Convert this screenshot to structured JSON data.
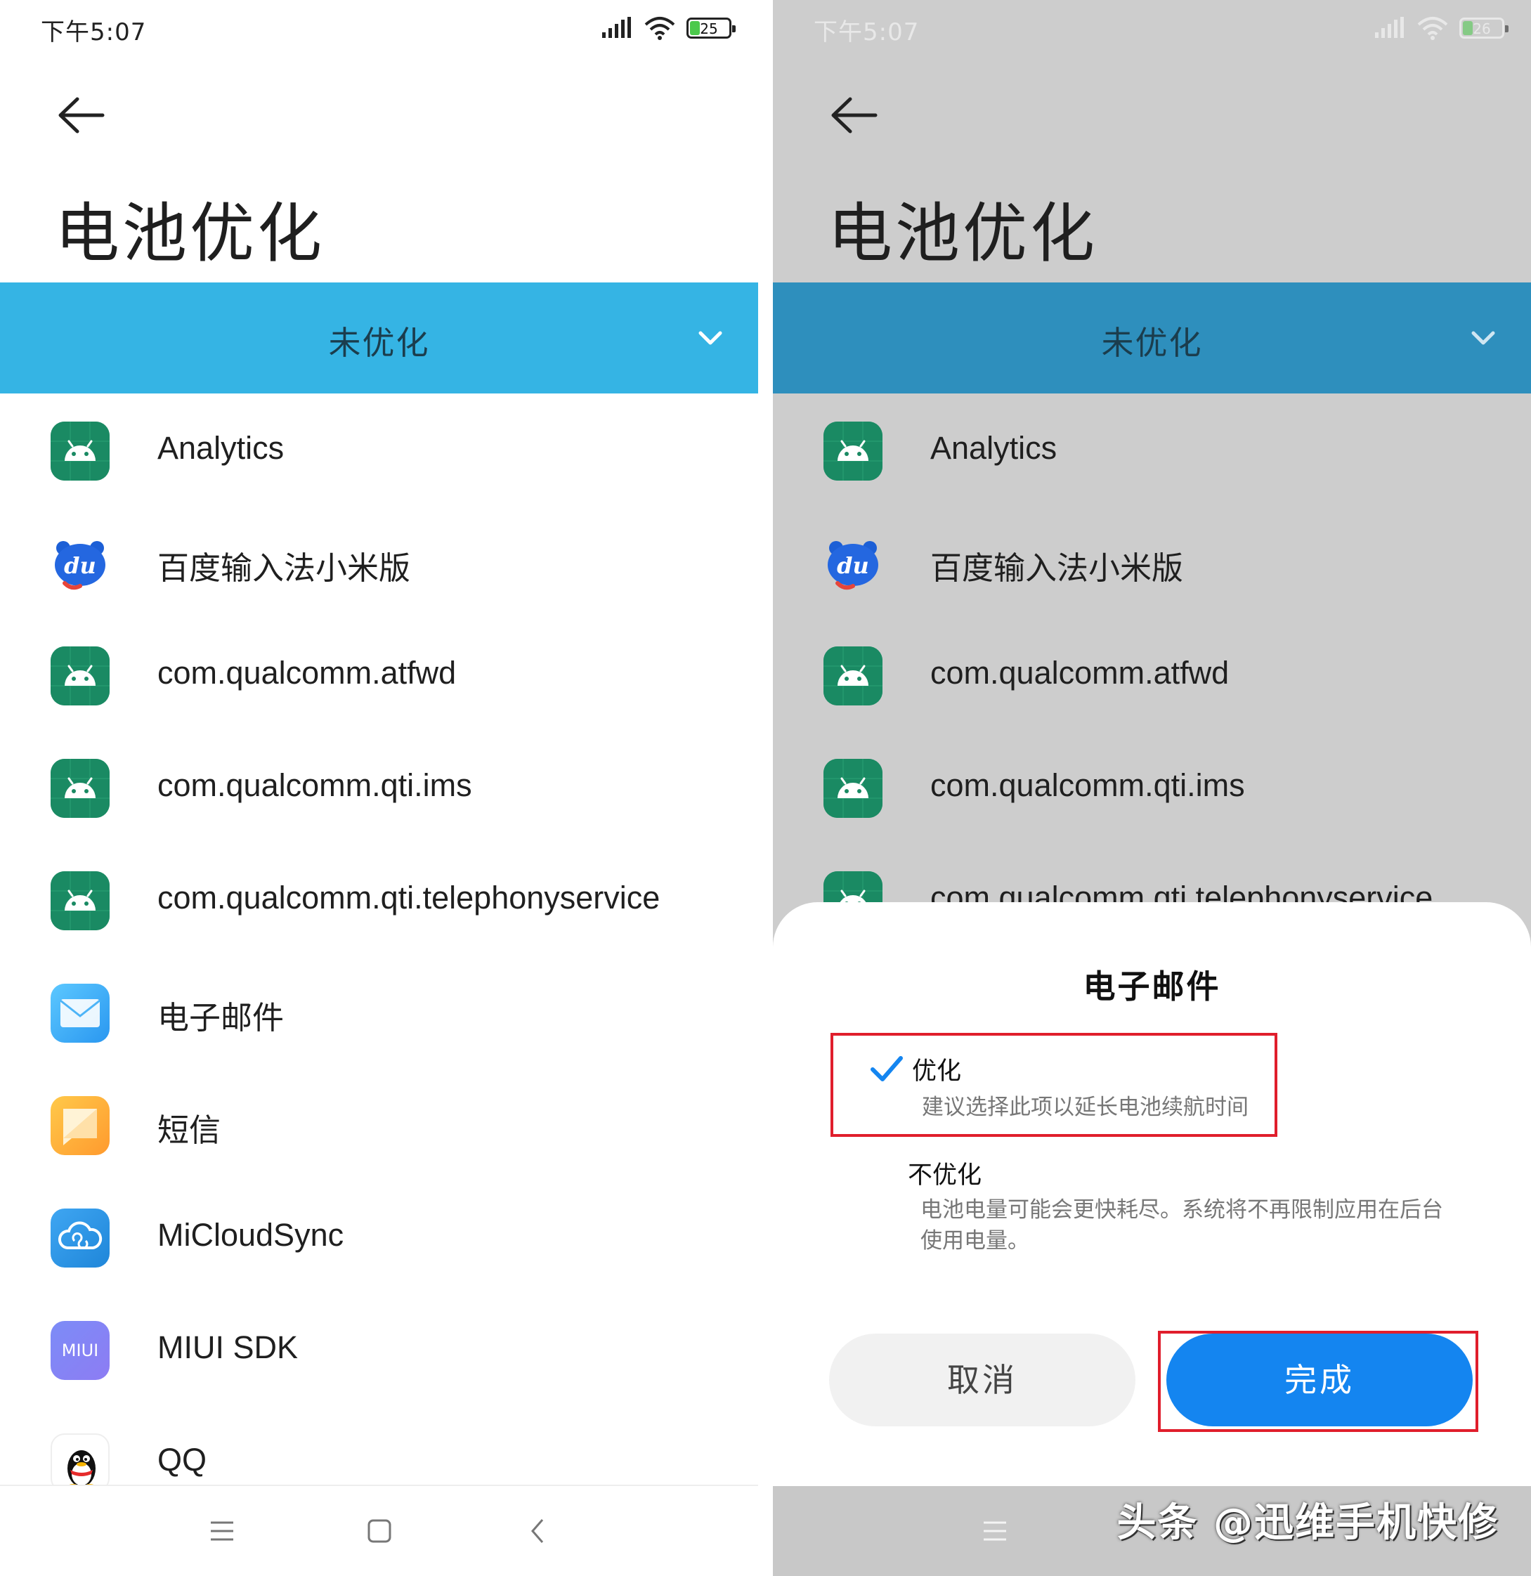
{
  "status": {
    "time": "下午5:07",
    "battery_left": "25",
    "battery_right": "26",
    "battery_left_level": 0.25,
    "battery_right_level": 0.26
  },
  "header": {
    "title": "电池优化"
  },
  "filter": {
    "label": "未优化"
  },
  "apps": [
    {
      "name": "Analytics",
      "icon": "android-icon"
    },
    {
      "name": "百度输入法小米版",
      "icon": "baidu-du-icon"
    },
    {
      "name": "com.qualcomm.atfwd",
      "icon": "android-icon"
    },
    {
      "name": "com.qualcomm.qti.ims",
      "icon": "android-icon"
    },
    {
      "name": "com.qualcomm.qti.telephonyservice",
      "icon": "android-icon"
    },
    {
      "name": "电子邮件",
      "icon": "mail-icon"
    },
    {
      "name": "短信",
      "icon": "sms-icon"
    },
    {
      "name": "MiCloudSync",
      "icon": "cloud-icon"
    },
    {
      "name": "MIUI SDK",
      "icon": "miui-icon",
      "badge": "MIUI"
    },
    {
      "name": "QQ",
      "icon": "qq-penguin-icon"
    }
  ],
  "dialog": {
    "title": "电子邮件",
    "option_optimize": {
      "label": "优化",
      "desc": "建议选择此项以延长电池续航时间",
      "selected": true
    },
    "option_no_optimize": {
      "label": "不优化",
      "desc": "电池电量可能会更快耗尽。系统将不再限制应用在后台使用电量。"
    },
    "cancel_label": "取消",
    "done_label": "完成"
  },
  "watermark": "头条 @迅维手机快修",
  "colors": {
    "filter_bar": "#35b4e4",
    "primary_button": "#1485f0",
    "highlight_border": "#e01e2c"
  }
}
